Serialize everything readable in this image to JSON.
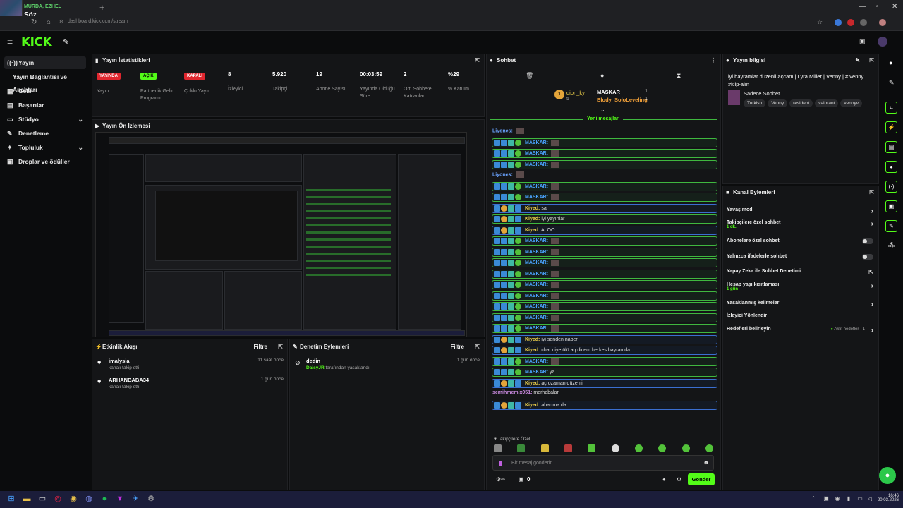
{
  "media": {
    "artist": "MURDA, EZHEL",
    "title": "Söz"
  },
  "browser": {
    "url": "dashboard.kick.com/stream"
  },
  "sidebar": {
    "items": [
      {
        "label": "Yayın",
        "icon": "broadcast-icon"
      },
      {
        "label": "Yayın Bağlantısı ve Anahtarı"
      },
      {
        "label": "Gelir",
        "icon": "wallet-icon"
      },
      {
        "label": "Başarılar",
        "icon": "trophy-icon"
      },
      {
        "label": "Stüdyo",
        "icon": "studio-icon"
      },
      {
        "label": "Denetleme",
        "icon": "hammer-icon"
      },
      {
        "label": "Topluluk",
        "icon": "community-icon"
      },
      {
        "label": "Droplar ve ödüller",
        "icon": "gift-icon"
      }
    ]
  },
  "stats": {
    "title": "Yayın İstatistikleri",
    "items": [
      {
        "badge": "YAYINDA",
        "badge_color": "#e0262e",
        "label": "Yayın"
      },
      {
        "badge": "AÇIK",
        "badge_color": "#53fc18",
        "label": "Partnerlik Gelir Programı"
      },
      {
        "badge": "KAPALI",
        "badge_color": "#e0262e",
        "label": "Çoklu Yayın"
      },
      {
        "value": "8",
        "label": "İzleyici"
      },
      {
        "value": "5.920",
        "label": "Takipçi"
      },
      {
        "value": "19",
        "label": "Abone Sayısı"
      },
      {
        "value": "00:03:59",
        "label": "Yayında Olduğu Süre"
      },
      {
        "value": "2",
        "label": "Ort. Sohbete Katılanlar"
      },
      {
        "value": "%29",
        "label": "% Katılım"
      }
    ]
  },
  "preview": {
    "title": "Yayın Ön İzlemesi"
  },
  "activity": {
    "title": "Etkinlik Akışı",
    "filter": "Filtre",
    "rows": [
      {
        "name": "imalysia",
        "sub": "kanalı takip etti",
        "time": "11 saat önce"
      },
      {
        "name": "ARHANBABA34",
        "sub": "kanalı takip etti",
        "time": "1 gün önce"
      }
    ]
  },
  "moderation": {
    "title": "Denetim Eylemleri",
    "filter": "Filtre",
    "rows": [
      {
        "name": "dedin",
        "by": "DaisyJR",
        "sub": "tarafından yasaklandı",
        "time": "1 gün önce"
      }
    ]
  },
  "chat": {
    "title": "Sohbet",
    "top": [
      {
        "rank": "1",
        "name": "dion_ky",
        "count": "5"
      }
    ],
    "top2": [
      {
        "name": "MASKAR",
        "count": "1"
      },
      {
        "name": "Blody_SoloLeveling",
        "count": "1"
      }
    ],
    "new_messages": "Yeni mesajlar",
    "messages": [
      {
        "plain": true,
        "user": "Liyones:",
        "text": ""
      },
      {
        "user": "MASKAR:",
        "text": "",
        "style": "green"
      },
      {
        "user": "MASKAR:",
        "text": "",
        "style": "green"
      },
      {
        "user": "MASKAR:",
        "text": "",
        "style": "green"
      },
      {
        "plain": true,
        "user": "Liyones:",
        "text": ""
      },
      {
        "user": "MASKAR:",
        "text": "",
        "style": "green"
      },
      {
        "user": "MASKAR:",
        "text": "",
        "style": "green"
      },
      {
        "user": "Kiyed:",
        "text": "sa",
        "style": "blue"
      },
      {
        "user": "Kiyed:",
        "text": "iyi yayınlar",
        "style": "green"
      },
      {
        "user": "Kiyed:",
        "text": "ALOO",
        "style": "blue"
      },
      {
        "user": "MASKAR:",
        "text": "",
        "style": "green"
      },
      {
        "user": "MASKAR:",
        "text": "",
        "style": "green"
      },
      {
        "user": "MASKAR:",
        "text": "",
        "style": "green"
      },
      {
        "user": "MASKAR:",
        "text": "",
        "style": "green"
      },
      {
        "user": "MASKAR:",
        "text": "",
        "style": "green"
      },
      {
        "user": "MASKAR:",
        "text": "",
        "style": "green"
      },
      {
        "user": "MASKAR:",
        "text": "",
        "style": "green"
      },
      {
        "user": "MASKAR:",
        "text": "",
        "style": "green"
      },
      {
        "user": "MASKAR:",
        "text": "",
        "style": "green"
      },
      {
        "user": "Kiyed:",
        "text": "iyi senden naber",
        "style": "blue"
      },
      {
        "user": "Kiyed:",
        "text": "chat niye ölü aq dicem herkes bayramda",
        "style": "blue"
      },
      {
        "user": "MASKAR:",
        "text": "",
        "style": "green"
      },
      {
        "user": "MASKAR:",
        "text": "ya",
        "style": "green"
      },
      {
        "user": "Kiyed:",
        "text": "aç ozaman düzenli",
        "style": "blue"
      },
      {
        "plain": true,
        "user": "semihmemix051:",
        "text": "merhabalar"
      },
      {
        "user": "Kiyed:",
        "text": "abartma da",
        "style": "blue"
      }
    ],
    "followers_only": "Takipçilere Özel",
    "input_placeholder": "Bir mesaj gönderin",
    "points": "0",
    "send": "Gönder"
  },
  "stream_info": {
    "title": "Yayın bilgisi",
    "stream_title": "iyi bayramlar düzenli açcam | Lyra Miller | Venny | #!venny #klip-alın",
    "category": "Sadece Sohbet",
    "tags": [
      "Turkish",
      "Venny",
      "resident",
      "valorant",
      "vennyv"
    ]
  },
  "channel_actions": {
    "title": "Kanal Eylemleri",
    "items": [
      {
        "label": "Yavaş mod",
        "control": "arrow"
      },
      {
        "label": "Takipçilere özel sohbet",
        "sub": "1 dk.",
        "control": "arrow"
      },
      {
        "label": "Abonelere özel sohbet",
        "control": "toggle"
      },
      {
        "label": "Yalnızca ifadelerle sohbet",
        "control": "toggle"
      },
      {
        "label": "Yapay Zeka ile Sohbet Denetimi",
        "control": "external"
      },
      {
        "label": "Hesap yaşı kısıtlaması",
        "sub": "1 gün",
        "control": "arrow"
      },
      {
        "label": "Yasaklanmış kelimeler",
        "control": "arrow"
      },
      {
        "label": "İzleyici Yönlendir",
        "control": "none"
      },
      {
        "label": "Hedefleri belirleyin",
        "right": "Aktif hedefler - 1",
        "control": "arrow"
      }
    ]
  },
  "taskbar": {
    "time": "16:46",
    "date": "20.03.2026"
  },
  "colors": {
    "kick_green": "#53fc18",
    "live_red": "#e0262e",
    "chat_blue": "#4aa3ff",
    "chat_yellow": "#f0d24a"
  }
}
